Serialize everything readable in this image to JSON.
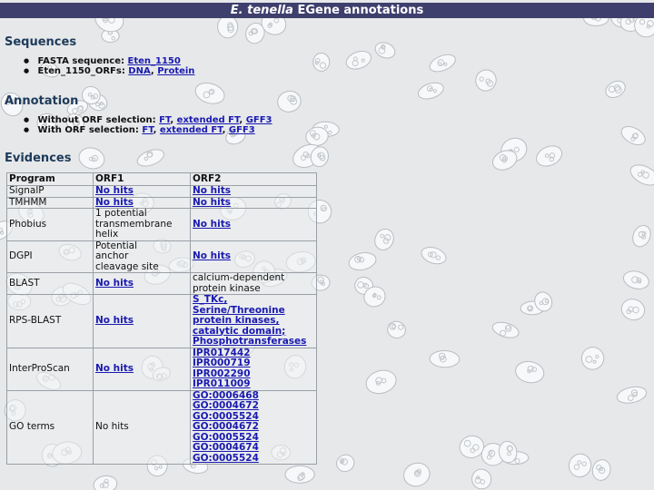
{
  "header": {
    "title_italic": "E. tenella",
    "title_rest": " EGene annotations"
  },
  "sequences": {
    "heading": "Sequences",
    "items": [
      {
        "label": "FASTA sequence: ",
        "links": [
          "Eten_1150"
        ]
      },
      {
        "label": "Eten_1150_ORFs: ",
        "links": [
          "DNA",
          "Protein"
        ]
      }
    ]
  },
  "annotation": {
    "heading": "Annotation",
    "items": [
      {
        "label": "Without ORF selection: ",
        "links": [
          "FT",
          "extended FT",
          "GFF3"
        ]
      },
      {
        "label": "With ORF selection: ",
        "links": [
          "FT",
          "extended FT",
          "GFF3"
        ]
      }
    ]
  },
  "evidences": {
    "heading": "Evidences",
    "columns": [
      "Program",
      "ORF1",
      "ORF2"
    ],
    "rows": [
      {
        "program": "SignalP",
        "orf1": [
          "No hits"
        ],
        "orf1_link": true,
        "orf2": [
          "No hits"
        ],
        "orf2_link": true
      },
      {
        "program": "TMHMM",
        "orf1": [
          "No hits"
        ],
        "orf1_link": true,
        "orf2": [
          "No hits"
        ],
        "orf2_link": true
      },
      {
        "program": "Phobius",
        "orf1": [
          "1 potential",
          "transmembrane",
          "helix"
        ],
        "orf1_link": false,
        "orf2": [
          "No hits"
        ],
        "orf2_link": true
      },
      {
        "program": "DGPI",
        "orf1": [
          "Potential",
          "anchor",
          "cleavage site"
        ],
        "orf1_link": false,
        "orf2": [
          "No hits"
        ],
        "orf2_link": true
      },
      {
        "program": "BLAST",
        "orf1": [
          "No hits"
        ],
        "orf1_link": true,
        "orf2": [
          "calcium-dependent",
          "protein kinase"
        ],
        "orf2_link": false
      },
      {
        "program": "RPS-BLAST",
        "orf1": [
          "No hits"
        ],
        "orf1_link": true,
        "orf2": [
          "S_TKc,",
          "Serine/Threonine",
          "protein kinases,",
          "catalytic domain;",
          "Phosphotransferases"
        ],
        "orf2_link": true
      },
      {
        "program": "InterProScan",
        "orf1": [
          "No hits"
        ],
        "orf1_link": true,
        "orf2": [
          "IPR017442",
          "IPR000719",
          "IPR002290",
          "IPR011009"
        ],
        "orf2_link": true
      },
      {
        "program": "GO terms",
        "orf1": [
          "No hits"
        ],
        "orf1_link": false,
        "orf2": [
          "GO:0006468",
          "GO:0004672",
          "GO:0005524",
          "GO:0004672",
          "GO:0005524",
          "GO:0004674",
          "GO:0005524"
        ],
        "orf2_link": true
      }
    ]
  },
  "colors": {
    "title_bar": "#3f3f6e",
    "heading": "#1e3a5a",
    "link": "#1a1ab0"
  }
}
